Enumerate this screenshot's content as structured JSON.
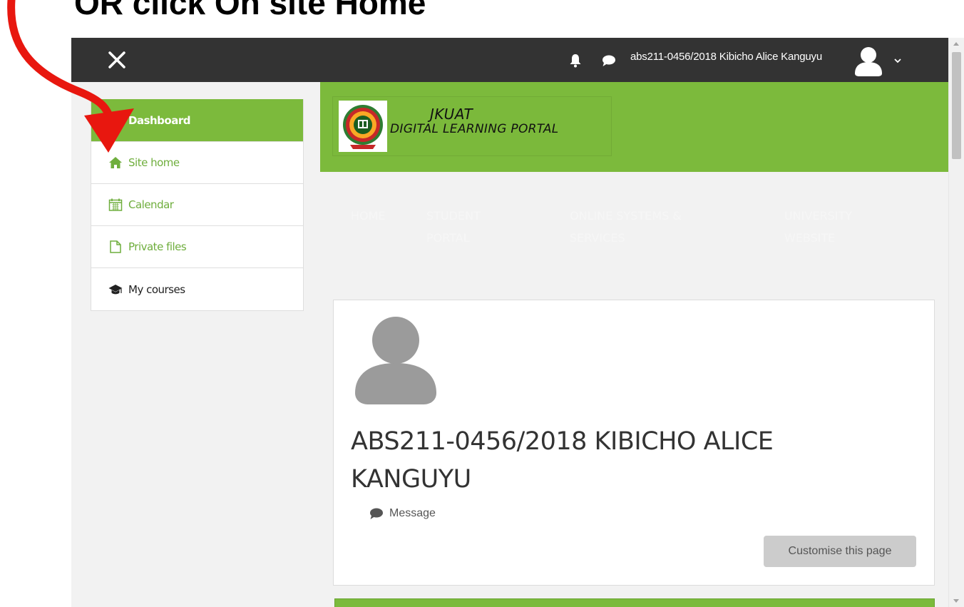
{
  "caption": "OR click On site Home",
  "topbar": {
    "username": "abs211-0456/2018 Kibicho Alice Kanguyu"
  },
  "sidebar": {
    "items": [
      {
        "label": "Dashboard",
        "icon": "dashboard-icon"
      },
      {
        "label": "Site home",
        "icon": "home-icon"
      },
      {
        "label": "Calendar",
        "icon": "calendar-icon"
      },
      {
        "label": "Private files",
        "icon": "file-icon"
      },
      {
        "label": "My courses",
        "icon": "graduation-cap-icon"
      }
    ]
  },
  "banner": {
    "logo_line1": "JKUAT",
    "logo_line2": "DIGITAL LEARNING PORTAL"
  },
  "menu": {
    "home": "HOME",
    "student_portal_1": "STUDENT",
    "student_portal_2": "PORTAL",
    "online_systems_1": "ONLINE SYSTEMS &",
    "online_systems_2": "SERVICES",
    "university_1": "UNIVERSITY",
    "university_2": "WEBSITE"
  },
  "profile": {
    "name_line1": "ABS211-0456/2018 KIBICHO ALICE",
    "name_line2": "KANGUYU",
    "message_label": "Message",
    "customise_label": "Customise this page"
  },
  "colors": {
    "topbar": "#333333",
    "brand_green": "#7cba3c",
    "link_green": "#6fae3d",
    "annotation_red": "#e8170f"
  }
}
